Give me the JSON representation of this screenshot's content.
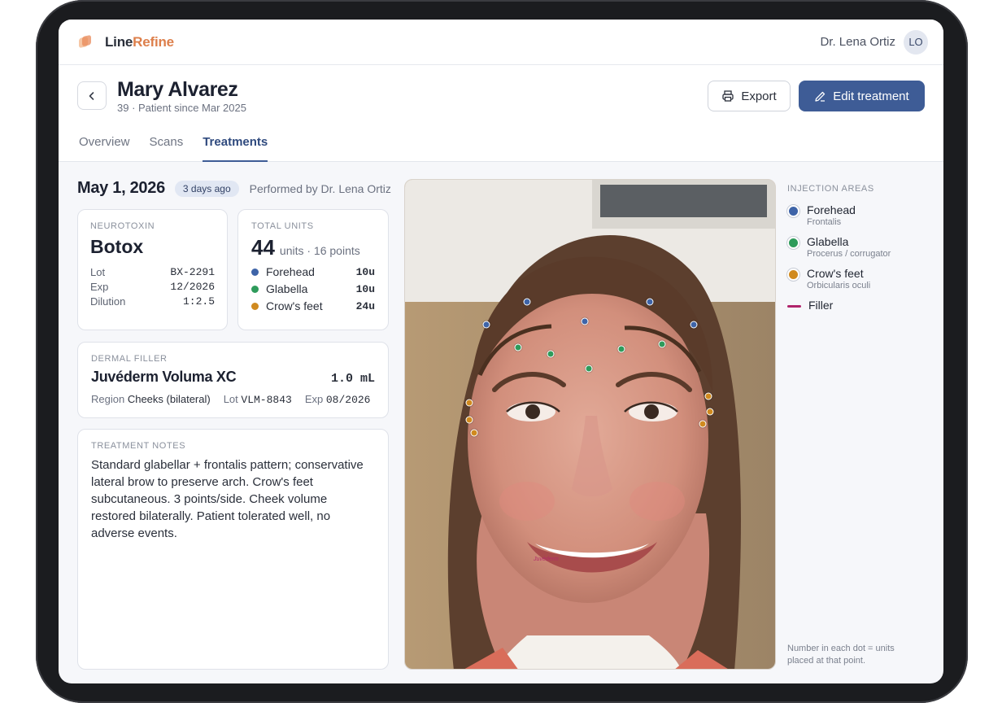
{
  "app": {
    "brand_part1": "Line",
    "brand_part2": "Refine",
    "user_name": "Dr. Lena Ortiz",
    "user_initials": "LO"
  },
  "patient": {
    "name": "Mary Alvarez",
    "subtitle": "39 · Patient since Mar 2025"
  },
  "actions": {
    "export_label": "Export",
    "edit_label": "Edit treatment"
  },
  "tabs": [
    {
      "label": "Overview"
    },
    {
      "label": "Scans"
    },
    {
      "label": "Treatments",
      "active": true
    }
  ],
  "treatment": {
    "date": "May 1, 2026",
    "ago": "3 days ago",
    "performed_by": "Performed by Dr. Lena Ortiz"
  },
  "neurotoxin": {
    "label": "NEUROTOXIN",
    "brand": "Botox",
    "rows": [
      {
        "k": "Lot",
        "v": "BX-2291"
      },
      {
        "k": "Exp",
        "v": "12/2026"
      },
      {
        "k": "Dilution",
        "v": "1:2.5"
      }
    ]
  },
  "total_units": {
    "label": "TOTAL UNITS",
    "value": "44",
    "sub": "units · 16 points",
    "rows": [
      {
        "name": "Forehead",
        "value": "10u",
        "color": "#3e64a8"
      },
      {
        "name": "Glabella",
        "value": "10u",
        "color": "#2e9b5b"
      },
      {
        "name": "Crow's feet",
        "value": "24u",
        "color": "#d08a1f"
      }
    ]
  },
  "filler": {
    "label": "DERMAL FILLER",
    "name": "Juvéderm Voluma XC",
    "volume": "1.0 mL",
    "region_k": "Region",
    "region_v": "Cheeks (bilateral)",
    "lot_k": "Lot",
    "lot_v": "VLM-8843",
    "exp_k": "Exp",
    "exp_v": "08/2026"
  },
  "notes": {
    "label": "TREATMENT NOTES",
    "text": "Standard glabellar + frontalis pattern; conservative lateral brow to preserve arch. Crow's feet subcutaneous. 3 points/side. Cheek volume restored bilaterally. Patient tolerated well, no adverse events."
  },
  "photo": {
    "filler_tag": "Juvéderm"
  },
  "legend": {
    "title": "INJECTION AREAS",
    "items": [
      {
        "name": "Forehead",
        "sub": "Frontalis",
        "color": "#3e64a8"
      },
      {
        "name": "Glabella",
        "sub": "Procerus / corrugator",
        "color": "#2e9b5b"
      },
      {
        "name": "Crow's feet",
        "sub": "Orbicularis oculi",
        "color": "#d08a1f"
      }
    ],
    "filler_label": "Filler",
    "filler_color": "#b0246b",
    "note": "Number in each dot = units placed at that point."
  }
}
